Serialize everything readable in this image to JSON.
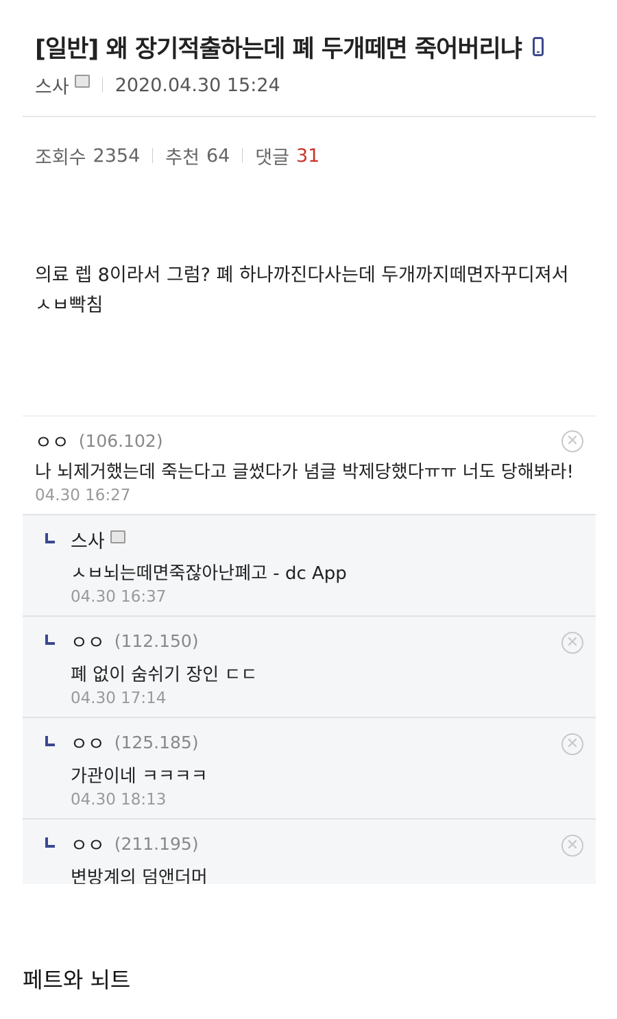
{
  "post": {
    "title": "[일반] 왜 장기적출하는데 폐 두개떼면 죽어버리냐",
    "author": "스사",
    "datetime": "2020.04.30 15:24",
    "views_label": "조회수",
    "views": "2354",
    "likes_label": "추천",
    "likes": "64",
    "comments_label": "댓글",
    "comments_count": "31",
    "body_line1": "의료 렙 8이라서 그럼? 폐 하나까진다사는데 두개까지떼면자꾸디져서",
    "body_line2": "ㅅㅂ빡침"
  },
  "comments": [
    {
      "name": "ㅇㅇ",
      "ip": "(106.102)",
      "text": "나 뇌제거했는데 죽는다고 글썼다가 념글 박제당했다ㅠㅠ 너도 당해봐라!",
      "date": "04.30 16:27"
    },
    {
      "name": "스사",
      "ip": "",
      "text": "ㅅㅂ뇌는떼면죽잖아난폐고 - dc App",
      "date": "04.30 16:37"
    },
    {
      "name": "ㅇㅇ",
      "ip": "(112.150)",
      "text": "폐 없이 숨쉬기 장인 ㄷㄷ",
      "date": "04.30 17:14"
    },
    {
      "name": "ㅇㅇ",
      "ip": "(125.185)",
      "text": "가관이네 ㅋㅋㅋㅋ",
      "date": "04.30 18:13"
    },
    {
      "name": "ㅇㅇ",
      "ip": "(211.195)",
      "text": "변방계의 덤앤더머",
      "date": ""
    }
  ],
  "caption": "페트와 뇌트",
  "icons": {
    "mobile": "mobile-phone-icon",
    "nick": "fixed-nick-icon",
    "delete": "delete-circle-icon",
    "reply": "reply-arrow-icon"
  },
  "colors": {
    "accent": "#3b4890",
    "comment_count": "#c5352c"
  }
}
